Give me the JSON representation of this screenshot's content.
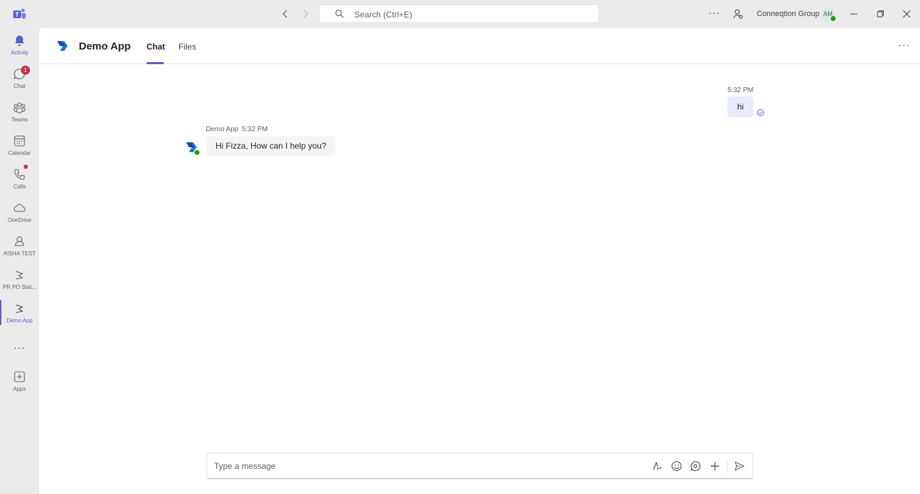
{
  "titlebar": {
    "search_placeholder": "Search (Ctrl+E)",
    "org_name": "Conneqtion Group",
    "avatar_initials": "AM"
  },
  "rail": {
    "items": [
      {
        "label": "Activity"
      },
      {
        "label": "Chat",
        "badge": "1"
      },
      {
        "label": "Teams"
      },
      {
        "label": "Calendar"
      },
      {
        "label": "Calls"
      },
      {
        "label": "OneDrive"
      },
      {
        "label": "AISHA TEST"
      },
      {
        "label": "PR PO Stat..."
      },
      {
        "label": "Demo App"
      },
      {
        "label": "Apps"
      }
    ]
  },
  "header": {
    "app_title": "Demo App",
    "tabs": [
      {
        "label": "Chat",
        "active": true
      },
      {
        "label": "Files",
        "active": false
      }
    ]
  },
  "messages": {
    "outgoing": {
      "time": "5:32 PM",
      "text": "hi"
    },
    "incoming": {
      "sender": "Demo App",
      "time": "5:32 PM",
      "text": "Hi Fizza, How can I help you?"
    }
  },
  "compose": {
    "placeholder": "Type a message"
  },
  "colors": {
    "accent": "#5b5fc7",
    "badge": "#c4314b",
    "presence": "#13a10e",
    "my_bubble": "#e8ebfa",
    "bot_bubble": "#f5f5f5"
  }
}
